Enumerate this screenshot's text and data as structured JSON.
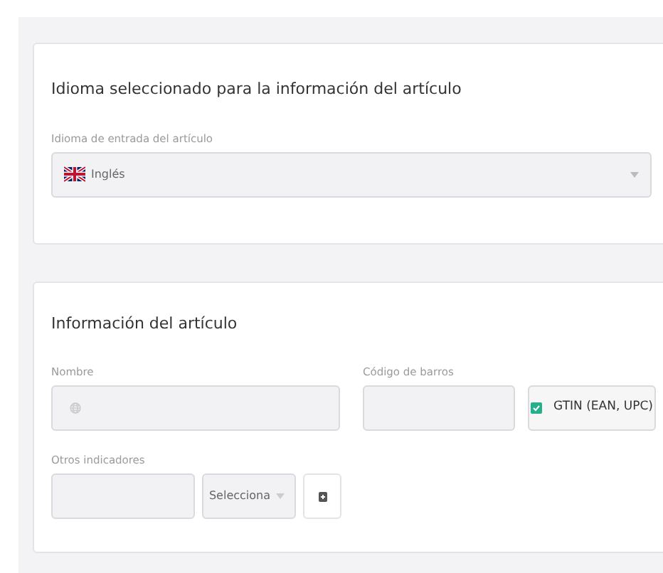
{
  "language_section": {
    "title": "Idioma seleccionado para la información del artículo",
    "field": {
      "label": "Idioma de entrada del artículo",
      "value": "Inglés"
    }
  },
  "item_section": {
    "title": "Información del artículo",
    "name_field": {
      "label": "Nombre"
    },
    "barcode_field": {
      "label": "Código de barros"
    },
    "gtin_toggle": {
      "label": "GTIN (EAN, UPC)",
      "checked": true
    },
    "other_indicators": {
      "label": "Otros indicadores",
      "select_value": "Selecciona"
    }
  }
}
